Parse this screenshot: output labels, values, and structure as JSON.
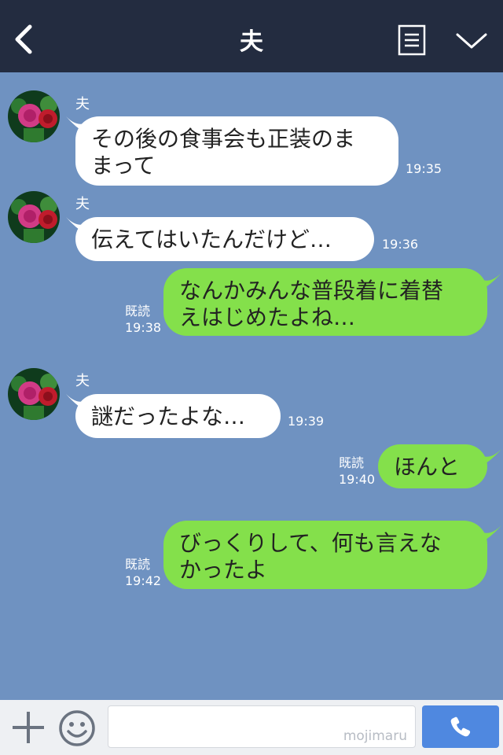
{
  "header": {
    "title": "夫"
  },
  "messages": [
    {
      "sender": "夫",
      "text": "その後の食事会も正装のま\nまって",
      "time": "19:35"
    },
    {
      "sender": "夫",
      "text": "伝えてはいたんだけど…",
      "time": "19:36"
    },
    {
      "read": "既読",
      "text": "なんかみんな普段着に着替\nえはじめたよね…",
      "time": "19:38"
    },
    {
      "sender": "夫",
      "text": "謎だったよな…",
      "time": "19:39"
    },
    {
      "read": "既読",
      "text": "ほんと",
      "time": "19:40"
    },
    {
      "read": "既読",
      "text": "びっくりして、何も言えな\nかったよ",
      "time": "19:42"
    }
  ],
  "input": {
    "watermark": "mojimaru"
  },
  "colors": {
    "header": "#232c40",
    "background": "#6f92c1",
    "incoming": "#ffffff",
    "outgoing": "#84e04b",
    "call": "#4f88e0"
  },
  "icons": [
    "back-arrow-icon",
    "memo-icon",
    "chevron-down-icon",
    "plus-icon",
    "emoji-icon",
    "phone-icon"
  ]
}
